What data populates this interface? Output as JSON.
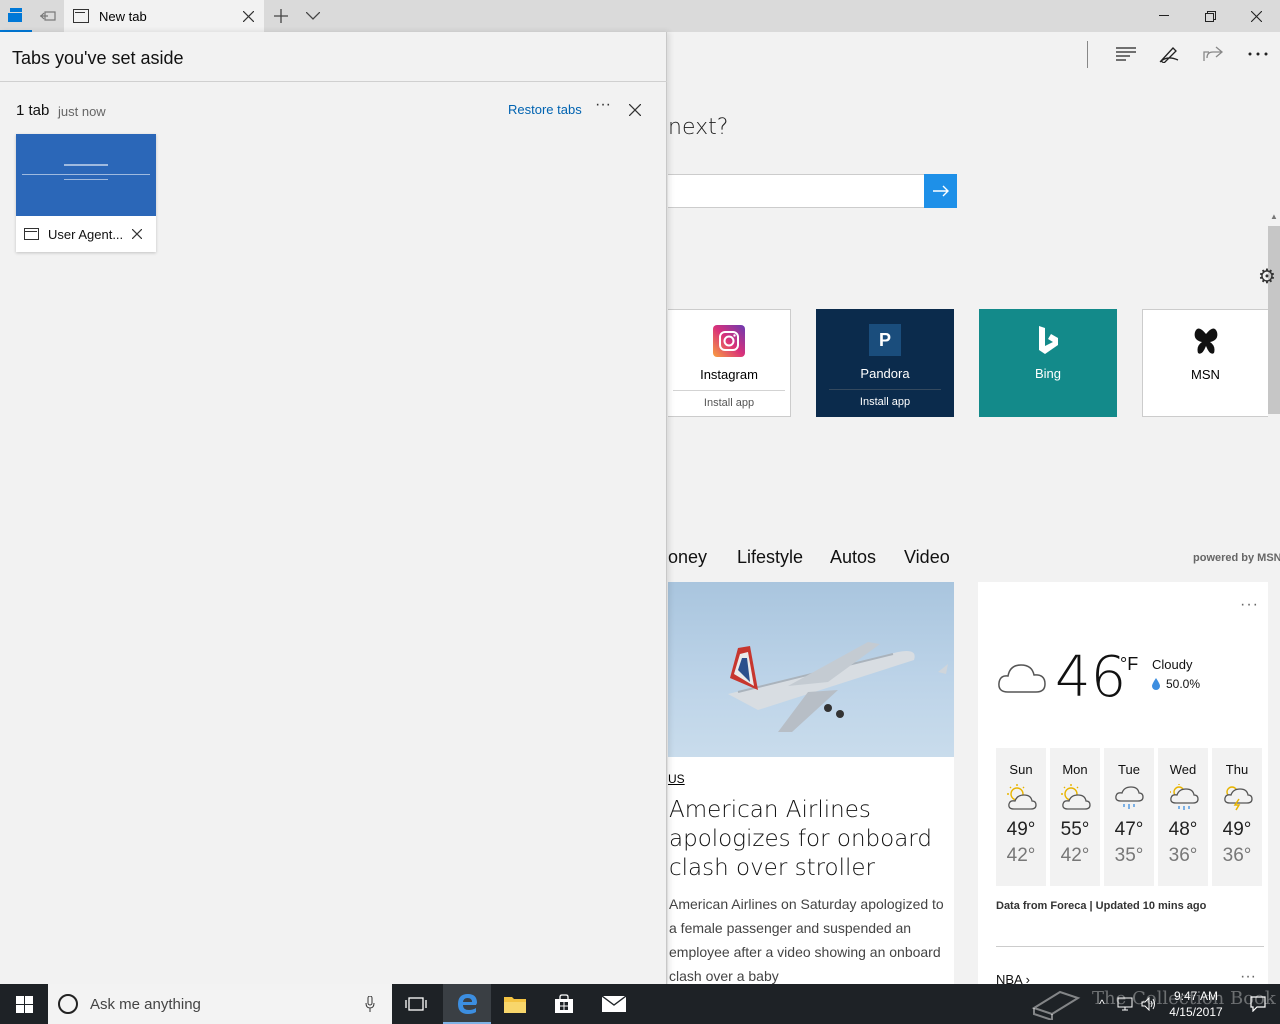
{
  "browser": {
    "tab_title": "New tab",
    "toolbar_icons": [
      "hub-icon",
      "pen-icon",
      "share-icon",
      "more-icon"
    ]
  },
  "panel": {
    "title": "Tabs you've set aside",
    "group_count": "1 tab",
    "group_time": "just now",
    "restore_label": "Restore tabs",
    "more_label": "···",
    "thumbnail_title": "User Agent..."
  },
  "ntp": {
    "question": "next?",
    "tiles": [
      {
        "name": "Instagram",
        "install": "Install app",
        "color": "#ffffff"
      },
      {
        "name": "Pandora",
        "install": "Install app",
        "color": "#0b2b4c"
      },
      {
        "name": "Bing",
        "color": "#138a8a"
      },
      {
        "name": "MSN",
        "color": "#ffffff"
      }
    ],
    "news_tabs": [
      "oney",
      "Lifestyle",
      "Autos",
      "Video"
    ],
    "powered_by": "powered by MSN",
    "article": {
      "tag": "US",
      "headline": "American Airlines apologizes for onboard clash over stroller",
      "body": "American Airlines on Saturday apologized to a female passenger and suspended an employee after a video showing an onboard clash over a baby"
    },
    "weather": {
      "more": "···",
      "temp": "46",
      "unit": "°F",
      "condition": "Cloudy",
      "precip": "50.0%",
      "forecast": [
        {
          "day": "Sun",
          "hi": "49°",
          "lo": "42°",
          "icon": "partly-sunny-icon"
        },
        {
          "day": "Mon",
          "hi": "55°",
          "lo": "42°",
          "icon": "partly-sunny-icon"
        },
        {
          "day": "Tue",
          "hi": "47°",
          "lo": "35°",
          "icon": "rain-cloud-icon"
        },
        {
          "day": "Wed",
          "hi": "48°",
          "lo": "36°",
          "icon": "sun-rain-icon"
        },
        {
          "day": "Thu",
          "hi": "49°",
          "lo": "36°",
          "icon": "thunder-icon"
        }
      ],
      "source": "Data from Foreca | Updated 10 mins ago",
      "nba": "NBA ›",
      "nba_more": "···"
    }
  },
  "taskbar": {
    "search_placeholder": "Ask me anything",
    "time": "9:47 AM",
    "date": "4/15/2017",
    "watermark": "The Collection Book"
  },
  "colors": {
    "accent": "#0078d7",
    "link": "#0063b1",
    "taskbar": "#1e2226"
  }
}
